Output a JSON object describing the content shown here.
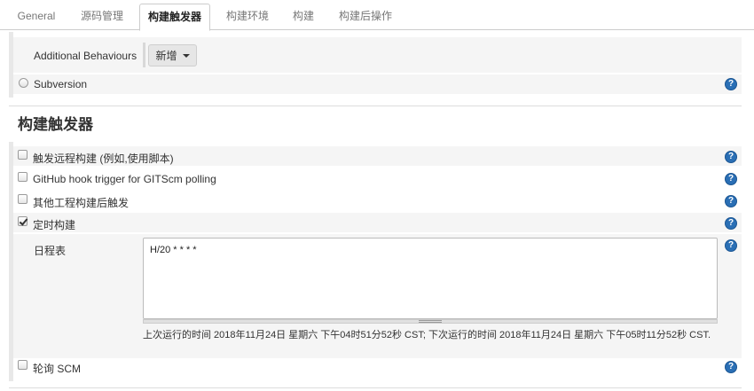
{
  "tabs": [
    {
      "label": "General",
      "active": false
    },
    {
      "label": "源码管理",
      "active": false
    },
    {
      "label": "构建触发器",
      "active": true
    },
    {
      "label": "构建环境",
      "active": false
    },
    {
      "label": "构建",
      "active": false
    },
    {
      "label": "构建后操作",
      "active": false
    }
  ],
  "scm": {
    "additional_behaviours_label": "Additional Behaviours",
    "add_button_label": "新增",
    "subversion_label": "Subversion"
  },
  "build_triggers": {
    "title": "构建触发器",
    "options": [
      {
        "label": "触发远程构建 (例如,使用脚本)",
        "checked": false
      },
      {
        "label": "GitHub hook trigger for GITScm polling",
        "checked": false
      },
      {
        "label": "其他工程构建后触发",
        "checked": false
      },
      {
        "label": "定时构建",
        "checked": true
      }
    ],
    "schedule": {
      "label": "日程表",
      "value": "H/20 * * * *",
      "info": "上次运行的时间 2018年11月24日 星期六 下午04时51分52秒 CST; 下次运行的时间 2018年11月24日 星期六 下午05时11分52秒 CST."
    },
    "poll_scm_label": "轮询 SCM"
  },
  "icons": {
    "help": "help-icon",
    "dropdown": "caret-down-icon"
  },
  "colors": {
    "help_icon": "#2a6fb5",
    "section_bar": "#e8e8e8",
    "row_background": "#f5f5f5"
  }
}
